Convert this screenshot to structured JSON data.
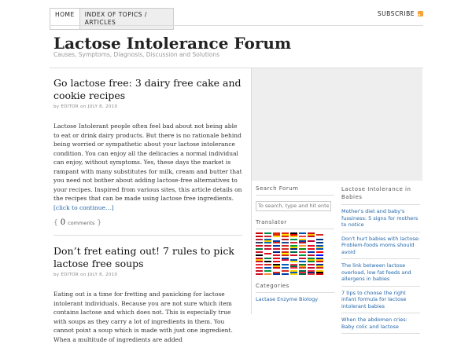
{
  "nav": {
    "home": "HOME",
    "index": "INDEX OF TOPICS / ARTICLES",
    "subscribe": "SUBSCRIBE"
  },
  "site": {
    "title": "Lactose Intolerance Forum",
    "description": "Causes, Symptoms, Diagnosis, Discussion and Solutions"
  },
  "posts": [
    {
      "title": "Go lactose free: 3 dairy free cake and cookie recipes",
      "meta": "by EDITOR on JULY 8, 2010",
      "excerpt": "Lactose Intolerant people often feel bad about not being able to eat or drink dairy products. But there is no rationale behind being worried or sympathetic about your lactose intolerance condition. You can enjoy all the delicacies a normal individual can enjoy, without symptoms. Yes, these days the market is rampant with many substitutes for milk, cream and butter that you need not bother about adding lactose-free alternatives to your recipes. Inspired from various sites, this article details on the recipes that can be made using lactose free ingredients.",
      "more": "[click to continue…]",
      "comments_count": "0",
      "comments_label": "comments"
    },
    {
      "title": "Don’t fret eating out! 7 rules to pick lactose free soups",
      "meta": "by EDITOR on JULY 8, 2010",
      "excerpt": "Eating out is a time for fretting and panicking for lactose intolerant individuals. Because you are not sure which item contains lactose and which does not. This is especially true with soups as they carry a lot of ingredients in them. You cannot point a soup which is made with just one ingredient. When a multitude of ingredients are added"
    }
  ],
  "sidebar": {
    "search_title": "Search Forum",
    "search_placeholder": "To search, type and hit enter",
    "translator_title": "Translator",
    "categories_title": "Categories",
    "categories": [
      "Lactase Enzyme Biology"
    ],
    "babies_title": "Lactose Intolerance in Babies",
    "babies_items": [
      "Mother's diet and baby's fussiness: 5 signs for mothers to notice",
      "Don't hurt babies with lactose: Problem-foods moms should avoid",
      "The link between lactose overload, low fat feeds and allergens in babies",
      "7 tips to choose the right infant formula for lactose intolerant babies",
      "When the abdomen cries: Baby colic and lactose"
    ]
  },
  "colors": {
    "link": "#2266aa",
    "rss": "#f7a33b",
    "sidebar_box": "#eeeeee"
  }
}
